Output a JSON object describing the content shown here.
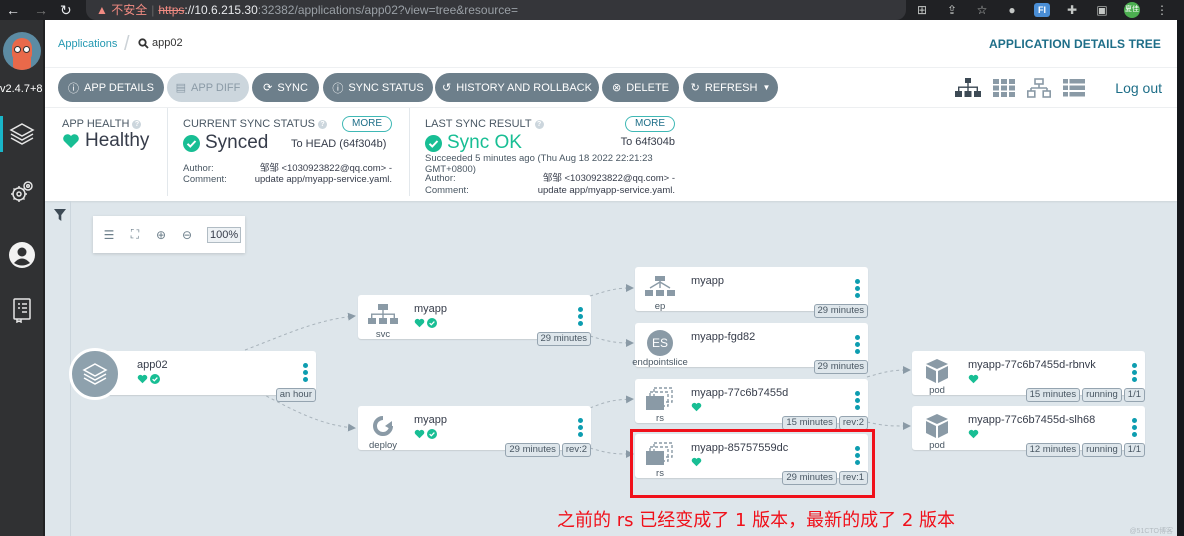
{
  "browser": {
    "warning": "不安全",
    "url_scheme": "https",
    "url_host": "://10.6.215.30",
    "url_rest": ":32382/applications/app02?view=tree&resource=",
    "profile_initials": "夏佳"
  },
  "sidebar": {
    "version": "v2.4.7+8",
    "items": [
      {
        "name": "applications",
        "icon": "layers-icon",
        "active": true
      },
      {
        "name": "settings",
        "icon": "gears-icon",
        "active": false
      },
      {
        "name": "user-info",
        "icon": "user-icon",
        "active": false
      },
      {
        "name": "documentation",
        "icon": "docs-icon",
        "active": false
      }
    ]
  },
  "header": {
    "breadcrumb_root": "Applications",
    "breadcrumb_current": "app02",
    "title": "APPLICATION DETAILS TREE"
  },
  "toolbar": {
    "buttons": [
      {
        "label": "APP DETAILS",
        "icon": "info-icon",
        "disabled": false
      },
      {
        "label": "APP DIFF",
        "icon": "file-icon",
        "disabled": true
      },
      {
        "label": "SYNC",
        "icon": "sync-icon",
        "disabled": false
      },
      {
        "label": "SYNC STATUS",
        "icon": "info-icon",
        "disabled": false
      },
      {
        "label": "HISTORY AND ROLLBACK",
        "icon": "history-icon",
        "disabled": false
      },
      {
        "label": "DELETE",
        "icon": "x-circle-icon",
        "disabled": false
      },
      {
        "label": "REFRESH",
        "icon": "refresh-icon",
        "disabled": false,
        "dropdown": true
      }
    ],
    "views": [
      "tree-view",
      "pods-view",
      "network-view",
      "list-view"
    ],
    "active_view": "tree-view",
    "logout": "Log out"
  },
  "status": {
    "health": {
      "label": "APP HEALTH",
      "value": "Healthy"
    },
    "sync": {
      "label": "CURRENT SYNC STATUS",
      "value": "Synced",
      "more": "MORE",
      "to": "To HEAD (64f304b)",
      "author_label": "Author:",
      "author": "邹邹 <1030923822@qq.com> -",
      "comment_label": "Comment:",
      "comment": "update app/myapp-service.yaml."
    },
    "last_sync": {
      "label": "LAST SYNC RESULT",
      "value": "Sync OK",
      "more": "MORE",
      "to": "To 64f304b",
      "succeeded_line1": "Succeeded 5 minutes ago (Thu Aug 18 2022 22:21:23",
      "succeeded_line2": "GMT+0800)",
      "author_label": "Author:",
      "author": "邹邹 <1030923822@qq.com> -",
      "comment_label": "Comment:",
      "comment": "update app/myapp-service.yaml."
    }
  },
  "graph": {
    "zoom": "100%",
    "app": {
      "name": "app02",
      "tags": [
        "an hour"
      ],
      "health": "healthy",
      "synced": true
    },
    "nodes": [
      {
        "id": "svc",
        "kind": "svc",
        "name": "myapp",
        "tags": [
          "29 minutes"
        ],
        "health": true,
        "synced": true
      },
      {
        "id": "deploy",
        "kind": "deploy",
        "name": "myapp",
        "tags": [
          "29 minutes",
          "rev:2"
        ],
        "health": true,
        "synced": true
      },
      {
        "id": "ep",
        "kind": "ep",
        "name": "myapp",
        "tags": [
          "29 minutes"
        ],
        "health": false,
        "synced": false
      },
      {
        "id": "es",
        "kind": "endpointslice",
        "badge": "ES",
        "name": "myapp-fgd82",
        "tags": [
          "29 minutes"
        ],
        "health": false,
        "synced": false
      },
      {
        "id": "rs1",
        "kind": "rs",
        "name": "myapp-77c6b7455d",
        "tags": [
          "15 minutes",
          "rev:2"
        ],
        "health": true,
        "synced": false
      },
      {
        "id": "rs2",
        "kind": "rs",
        "name": "myapp-85757559dc",
        "tags": [
          "29 minutes",
          "rev:1"
        ],
        "health": true,
        "synced": false
      },
      {
        "id": "pod1",
        "kind": "pod",
        "name": "myapp-77c6b7455d-rbnvk",
        "tags": [
          "15 minutes",
          "running",
          "1/1"
        ],
        "health": true,
        "synced": false
      },
      {
        "id": "pod2",
        "kind": "pod",
        "name": "myapp-77c6b7455d-slh68",
        "tags": [
          "12 minutes",
          "running",
          "1/1"
        ],
        "health": true,
        "synced": false
      }
    ]
  },
  "annotation": "之前的 rs 已经变成了 1 版本，最新的成了 2 版本",
  "watermark": "@51CTO博客",
  "colors": {
    "accent": "#19b6c9",
    "healthy": "#18be94",
    "button": "#6d7f8b",
    "highlight": "#f0101a",
    "link": "#1e6e88"
  }
}
